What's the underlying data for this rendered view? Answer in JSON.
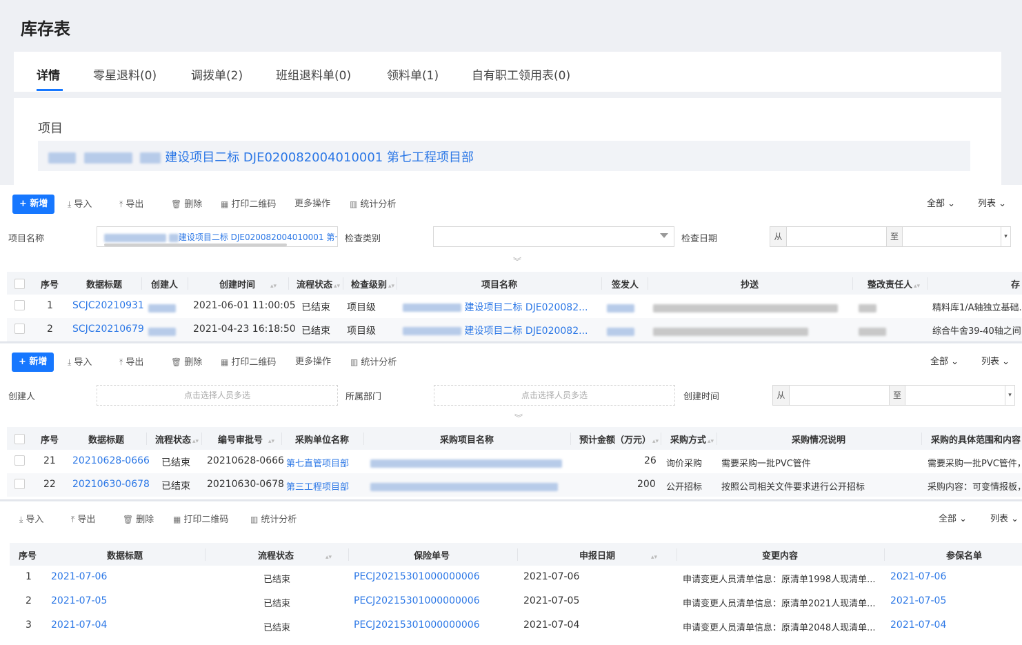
{
  "page": {
    "title": "库存表"
  },
  "tabs": [
    {
      "label": "详情"
    },
    {
      "label": "零星退料(0)"
    },
    {
      "label": "调拨单(2)"
    },
    {
      "label": "班组退料单(0)"
    },
    {
      "label": "领料单(1)"
    },
    {
      "label": "自有职工领用表(0)"
    }
  ],
  "project": {
    "label": "项目",
    "value": "建设项目二标 DJE020082004010001 第七工程项目部"
  },
  "panel1": {
    "toolbar": {
      "add": "+ 新增",
      "import": "导入",
      "export": "导出",
      "delete": "删除",
      "print_qr": "打印二维码",
      "more": "更多操作",
      "stats": "统计分析",
      "scope": "全部",
      "view": "列表"
    },
    "filters": {
      "project_name_label": "项目名称",
      "project_name_value": "建设项目二标 DJE020082004010001 第七工程",
      "check_type_label": "检查类别",
      "check_date_label": "检查日期",
      "from": "从",
      "to": "至"
    },
    "columns": [
      "序号",
      "数据标题",
      "创建人",
      "创建时间",
      "流程状态",
      "检查级别",
      "项目名称",
      "签发人",
      "抄送",
      "整改责任人",
      "存"
    ],
    "rows": [
      {
        "no": "1",
        "title": "SCJC20210931",
        "created": "2021-06-01 11:00:05",
        "status": "已结束",
        "level": "项目级",
        "project": "建设项目二标 DJE020082...",
        "location": "精料库1/A轴独立基础..."
      },
      {
        "no": "2",
        "title": "SCJC20210679",
        "created": "2021-04-23 16:18:50",
        "status": "已结束",
        "level": "项目级",
        "project": "建设项目二标 DJE020082...",
        "location": "综合牛舍39-40轴之间"
      }
    ]
  },
  "panel2": {
    "toolbar": {
      "add": "+ 新增",
      "import": "导入",
      "export": "导出",
      "delete": "删除",
      "print_qr": "打印二维码",
      "more": "更多操作",
      "stats": "统计分析",
      "scope": "全部",
      "view": "列表"
    },
    "filters": {
      "creator_label": "创建人",
      "creator_placeholder": "点击选择人员多选",
      "dept_label": "所属部门",
      "dept_placeholder": "点击选择人员多选",
      "created_label": "创建时间",
      "from": "从",
      "to": "至"
    },
    "columns": [
      "序号",
      "数据标题",
      "流程状态",
      "编号审批号",
      "采购单位名称",
      "采购项目名称",
      "预计金额（万元）",
      "采购方式",
      "采购情况说明",
      "采购的具体范围和内容"
    ],
    "rows": [
      {
        "no": "21",
        "title": "20210628-0666",
        "status": "已结束",
        "approval": "20210628-0666",
        "unit": "第七直管项目部",
        "amount": "26",
        "method": "询价采购",
        "desc": "需要采购一批PVC管件",
        "scope": "需要采购一批PVC管件，"
      },
      {
        "no": "22",
        "title": "20210630-0678",
        "status": "已结束",
        "approval": "20210630-0678",
        "unit": "第三工程项目部",
        "amount": "200",
        "method": "公开招标",
        "desc": "按照公司相关文件要求进行公开招标",
        "scope": "采购内容：可变情报板，"
      }
    ]
  },
  "panel3": {
    "toolbar": {
      "import": "导入",
      "export": "导出",
      "delete": "删除",
      "print_qr": "打印二维码",
      "stats": "统计分析",
      "scope": "全部",
      "view": "列表"
    },
    "columns": [
      "序号",
      "数据标题",
      "流程状态",
      "保险单号",
      "申报日期",
      "变更内容",
      "参保名单"
    ],
    "rows": [
      {
        "no": "1",
        "title": "2021-07-06",
        "status": "已结束",
        "policy": "PECJ20215301000000006",
        "date": "2021-07-06",
        "change": "申请变更人员清单信息：原清单1998人现清单...",
        "list": "2021-07-06"
      },
      {
        "no": "2",
        "title": "2021-07-05",
        "status": "已结束",
        "policy": "PECJ20215301000000006",
        "date": "2021-07-05",
        "change": "申请变更人员清单信息：原清单2021人现清单...",
        "list": "2021-07-05"
      },
      {
        "no": "3",
        "title": "2021-07-04",
        "status": "已结束",
        "policy": "PECJ20215301000000006",
        "date": "2021-07-04",
        "change": "申请变更人员清单信息：原清单2048人现清单...",
        "list": "2021-07-04"
      }
    ]
  },
  "colors": {
    "primary": "#1677ff",
    "link": "#2b77e6",
    "header_bg": "#f3f5f8"
  }
}
